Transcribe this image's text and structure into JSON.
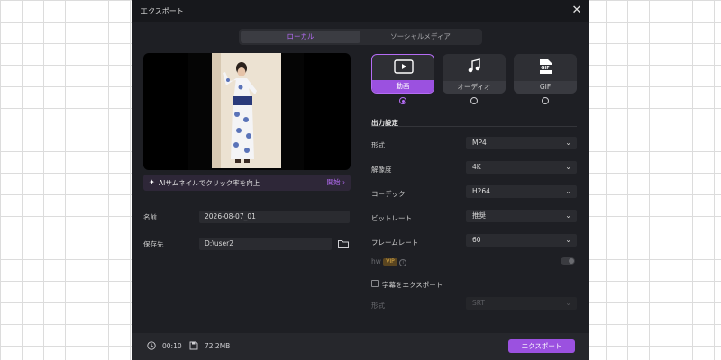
{
  "dialog": {
    "title": "エクスポート"
  },
  "tabs": [
    {
      "label": "ローカル"
    },
    {
      "label": "ソーシャルメディア"
    }
  ],
  "ai_bar": {
    "text": "AIサムネイルでクリック率を向上",
    "action": "開始"
  },
  "file": {
    "name_label": "名前",
    "name_value": "2026-08-07_01",
    "path_label": "保存先",
    "path_value": "D:\\user2"
  },
  "formats": [
    {
      "label": "動画",
      "selected": true,
      "icon": "video-icon"
    },
    {
      "label": "オーディオ",
      "selected": false,
      "icon": "music-note-icon"
    },
    {
      "label": "GIF",
      "selected": false,
      "icon": "gif-icon"
    }
  ],
  "settings": {
    "section_title": "出力設定",
    "rows": [
      {
        "label": "形式",
        "value": "MP4"
      },
      {
        "label": "解像度",
        "value": "4K"
      },
      {
        "label": "コーデック",
        "value": "H264"
      },
      {
        "label": "ビットレート",
        "value": "推奨"
      },
      {
        "label": "フレームレート",
        "value": "60"
      }
    ],
    "hw_label": "hw",
    "vip_badge": "VIP",
    "subtitle_export_label": "字幕をエクスポート",
    "subtitle_format_label": "形式",
    "subtitle_format_value": "SRT"
  },
  "footer": {
    "duration": "00:10",
    "size": "72.2MB",
    "export_label": "エクスポート"
  },
  "colors": {
    "accent": "#9b51e0",
    "accent_text": "#b56cf5",
    "dialog_bg": "#1e1f24"
  }
}
